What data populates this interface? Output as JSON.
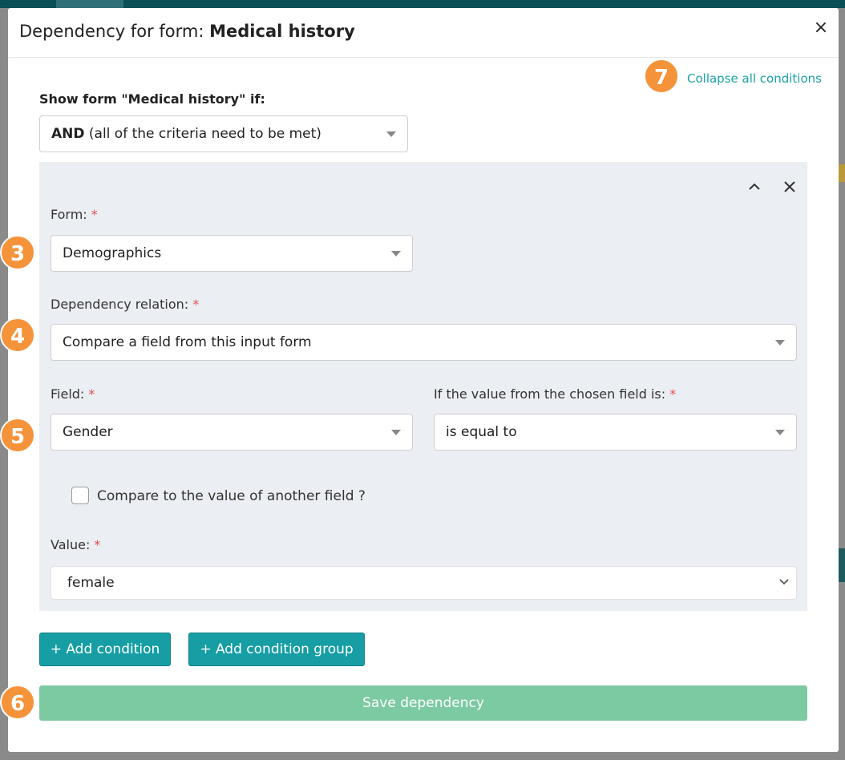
{
  "modal": {
    "title_prefix": "Dependency for form: ",
    "title_form": "Medical history",
    "close_glyph": "×"
  },
  "collapse_all_label": "Collapse all conditions",
  "show_form_label": "Show form \"Medical history\" if:",
  "logic_select": {
    "value_bold": "AND",
    "value_rest": " (all of the criteria need to be met)"
  },
  "condition": {
    "form_label": "Form:",
    "form_value": "Demographics",
    "relation_label": "Dependency relation:",
    "relation_value": "Compare a field from this input form",
    "field_label": "Field:",
    "field_value": "Gender",
    "comparison_label": "If the value from the chosen field is:",
    "comparison_value": "is equal to",
    "compare_other_label": "Compare to the value of another field ?",
    "compare_other_checked": false,
    "value_label": "Value:",
    "value_value": "female",
    "required_mark": "*"
  },
  "buttons": {
    "add_condition": "+ Add condition",
    "add_condition_group": "+ Add condition group",
    "save": "Save dependency"
  },
  "badges": {
    "b3": "3",
    "b4": "4",
    "b5": "5",
    "b6": "6",
    "b7": "7"
  },
  "colors": {
    "accent": "#169ea4",
    "save": "#7ccaa2",
    "badge": "#f5933a",
    "panel": "#ebeef2",
    "required": "#e05050"
  },
  "icons": {
    "close": "close-icon",
    "collapse": "chevron-up-icon",
    "remove": "close-icon",
    "dropdown": "caret-down-icon"
  }
}
